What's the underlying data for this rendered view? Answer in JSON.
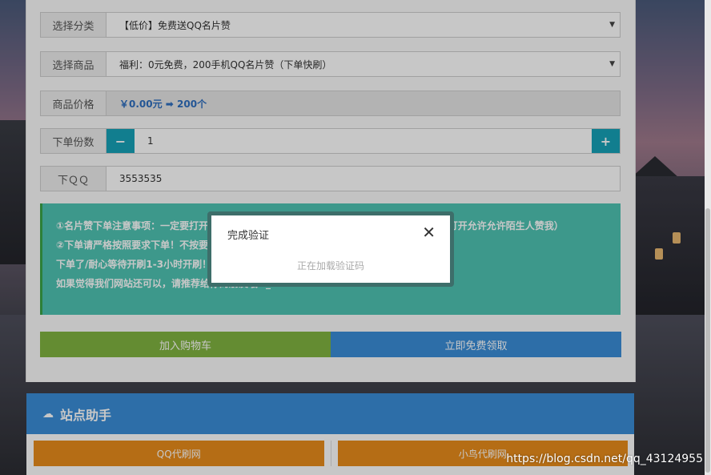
{
  "form": {
    "category": {
      "label": "选择分类",
      "value": "【低价】免费送QQ名片赞"
    },
    "product": {
      "label": "选择商品",
      "value": "福利：0元免费，200手机QQ名片赞（下单快刷）"
    },
    "price": {
      "label": "商品价格",
      "value": "￥0.00元 ➡ 200个"
    },
    "quantity": {
      "label": "下单份数",
      "value": "1",
      "minus": "−",
      "plus": "+"
    },
    "qq": {
      "label": "下ＱＱ",
      "value": "3553535"
    }
  },
  "notice": {
    "lines": [
      "①名片赞下单注意事项：一定要打开名片赞陌生人赞同（例如：打开QQ-设置-联系人、隐私-打开允许允许陌生人赞我）",
      "②下单请严格按照要求下单！不按要求下单不会补单不退款！",
      "下单了/耐心等待开刷1-3小时开刷！",
      "如果觉得我们网站还可以，请推荐给你的朋友哦^_^"
    ]
  },
  "actions": {
    "cart": "加入购物车",
    "buy": "立即免费领取"
  },
  "helper": {
    "title": "站点助手",
    "icon": "cloud-icon",
    "links": [
      "QQ代刷网",
      "小鸟代刷网"
    ]
  },
  "modal": {
    "title": "完成验证",
    "close": "✕",
    "message": "正在加载验证码"
  },
  "watermark": "https://blog.csdn.net/qq_43124955"
}
